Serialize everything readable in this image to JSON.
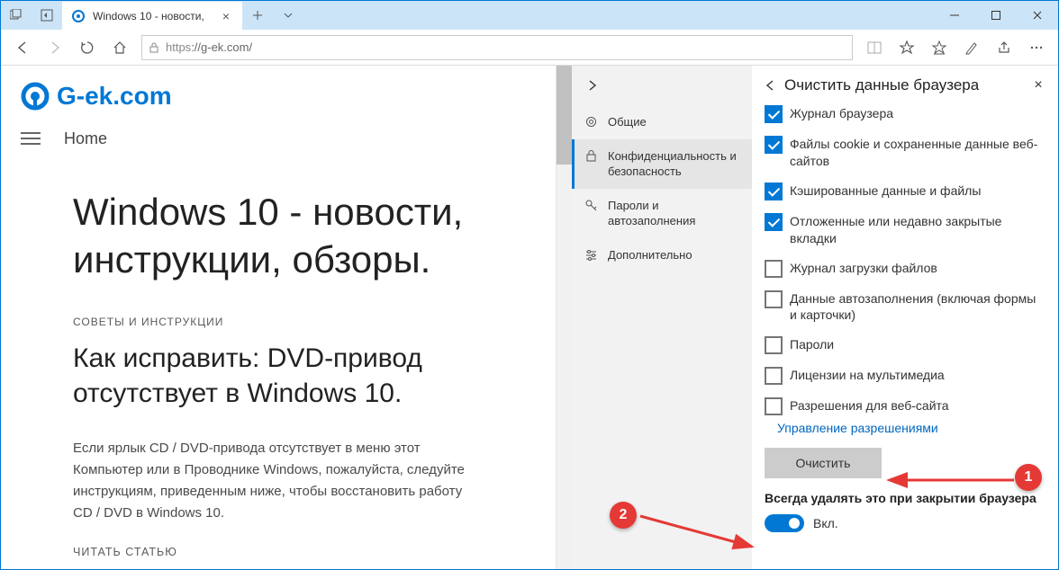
{
  "tab": {
    "title": "Windows 10 - новости,"
  },
  "url": {
    "proto": "https",
    "rest": "://g-ek.com/"
  },
  "logo": {
    "text": "G-ek.com"
  },
  "nav": {
    "home": "Home"
  },
  "article": {
    "h1": "Windows 10 - новости, инструкции, обзоры.",
    "tag": "СОВЕТЫ И ИНСТРУКЦИИ",
    "h2": "Как исправить: DVD-привод отсутствует в Windows 10.",
    "p": "Если ярлык CD / DVD-привода отсутствует в меню этот Компьютер или в Проводнике Windows, пожалуйста, следуйте инструкциям, приведенным ниже, чтобы восстановить работу CD / DVD в Windows 10.",
    "readmore": "ЧИТАТЬ СТАТЬЮ"
  },
  "mid": {
    "items": [
      {
        "label": "Общие"
      },
      {
        "label": "Конфиденциальность и безопасность"
      },
      {
        "label": "Пароли и автозаполнения"
      },
      {
        "label": "Дополнительно"
      }
    ]
  },
  "rp": {
    "title": "Очистить данные браузера",
    "checks": [
      {
        "label": "Журнал браузера",
        "checked": true
      },
      {
        "label": "Файлы cookie и сохраненные данные веб-сайтов",
        "checked": true
      },
      {
        "label": "Кэшированные данные и файлы",
        "checked": true
      },
      {
        "label": "Отложенные или недавно закрытые вкладки",
        "checked": true
      },
      {
        "label": "Журнал загрузки файлов",
        "checked": false
      },
      {
        "label": "Данные автозаполнения (включая формы и карточки)",
        "checked": false
      },
      {
        "label": "Пароли",
        "checked": false
      },
      {
        "label": "Лицензии на мультимедиа",
        "checked": false
      },
      {
        "label": "Разрешения для веб-сайта",
        "checked": false
      }
    ],
    "manage_link": "Управление разрешениями",
    "clear_btn": "Очистить",
    "toggle_title": "Всегда удалять это при закрытии браузера",
    "toggle_label": "Вкл."
  },
  "badges": {
    "one": "1",
    "two": "2"
  }
}
